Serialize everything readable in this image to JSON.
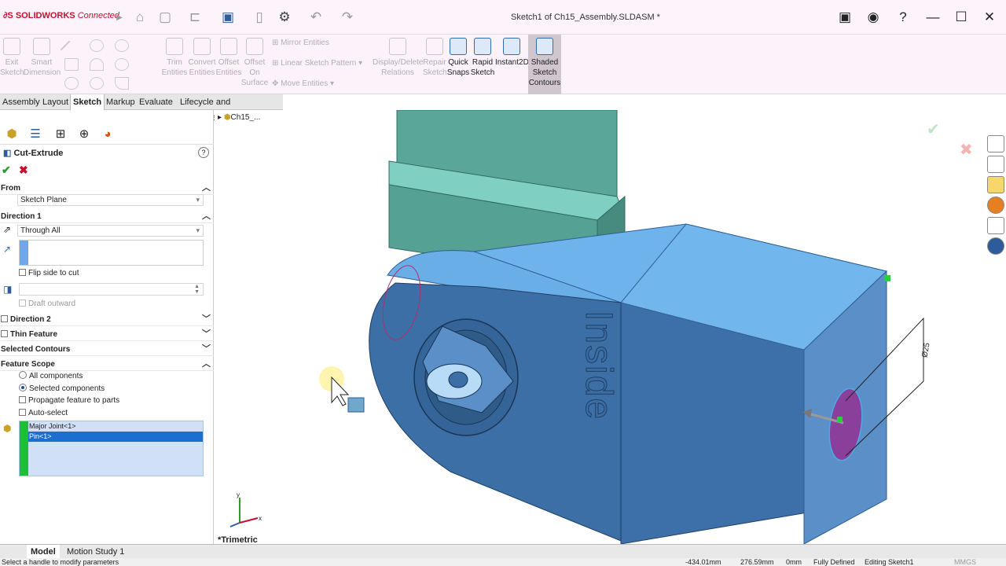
{
  "app": {
    "logo_brand": "SOLIDWORKS",
    "logo_suffix": "Connected",
    "doc_title": "Sketch1 of Ch15_Assembly.SLDASM *"
  },
  "ribbon": {
    "exit_sketch": "Exit Sketch",
    "smart_dimension": "Smart Dimension",
    "trim_entities": "Trim Entities",
    "convert_entities": "Convert Entities",
    "offset_entities": "Offset Entities",
    "offset_on_surface": "Offset On Surface",
    "mirror_entities": "Mirror Entities",
    "linear_pattern": "Linear Sketch Pattern",
    "move_entities": "Move Entities",
    "display_delete": "Display/Delete Relations",
    "repair_sketch": "Repair Sketch",
    "quick_snaps": "Quick Snaps",
    "rapid_sketch": "Rapid Sketch",
    "instant2d": "Instant2D",
    "shaded_contours": "Shaded Sketch Contours"
  },
  "tabs": [
    "Assembly",
    "Layout",
    "Sketch",
    "Markup",
    "Evaluate",
    "Lifecycle and Collaboration"
  ],
  "active_tab": "Sketch",
  "panel": {
    "title": "Cut-Extrude",
    "from_label": "From",
    "from_value": "Sketch Plane",
    "dir1_label": "Direction 1",
    "dir1_value": "Through All",
    "flip_side": "Flip side to cut",
    "draft_outward": "Draft outward",
    "dir2_label": "Direction 2",
    "thin_label": "Thin Feature",
    "contours_label": "Selected Contours",
    "scope_label": "Feature Scope",
    "scope_all": "All components",
    "scope_selected": "Selected components",
    "propagate": "Propagate feature to parts",
    "auto_select": "Auto-select",
    "components": [
      "Major Joint<1>",
      "Pin<1>"
    ]
  },
  "viewport": {
    "tree_root": "Ch15_...",
    "view_name": "*Trimetric",
    "engraved_text": "Inside",
    "dimension": "Ø25",
    "axis_x": "x",
    "axis_y": "y"
  },
  "bottom": {
    "model_tab": "Model",
    "motion_tab": "Motion Study 1"
  },
  "status": {
    "hint": "Select a handle to modify parameters",
    "x": "-434.01mm",
    "y": "276.59mm",
    "z": "0mm",
    "state": "Fully Defined",
    "mode": "Editing Sketch1",
    "units": "MMGS"
  },
  "colors": {
    "part_top": "#6fb3ec",
    "part_front": "#3c6fa6",
    "part_side": "#5b8fc8",
    "pin": "#5aa799",
    "accent": "#c8102e"
  }
}
